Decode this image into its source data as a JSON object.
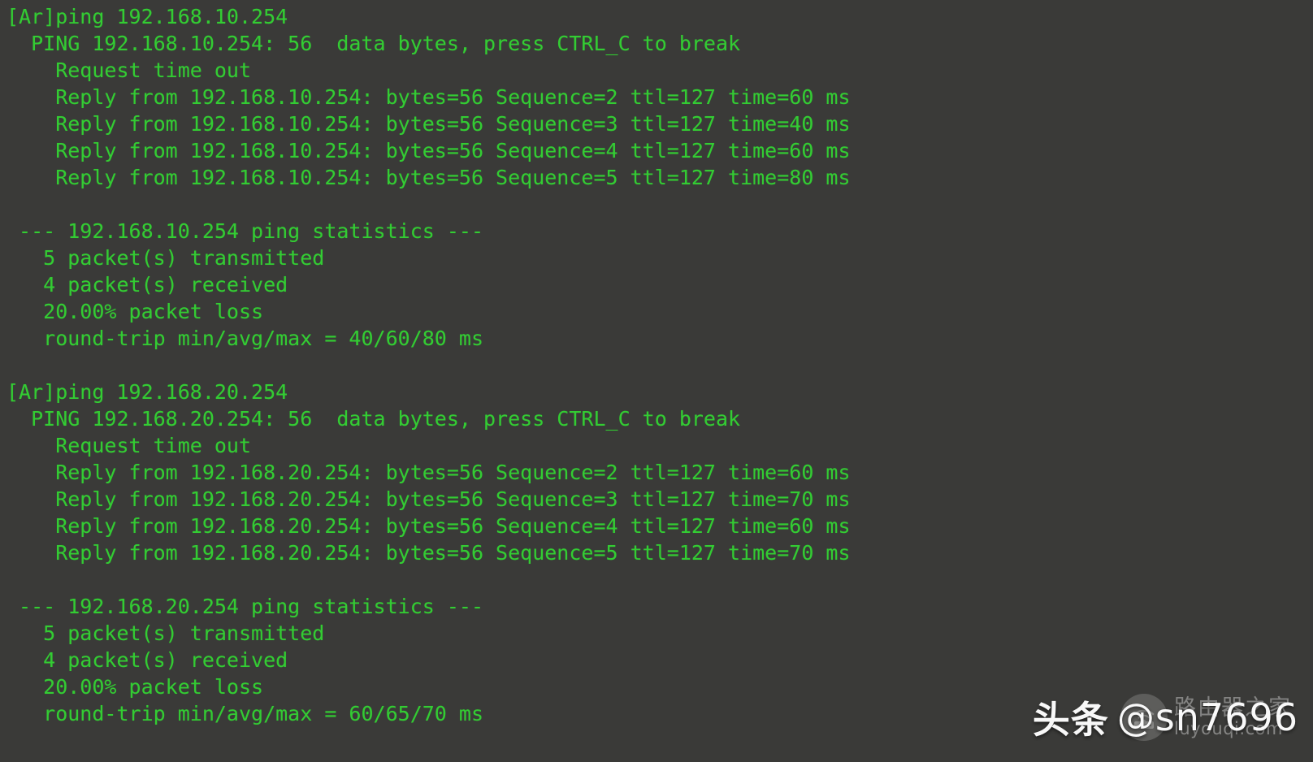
{
  "terminal": {
    "prompt_prefix": "[Ar]",
    "foreground_color": "#33cc33",
    "background_color": "#3a3a38",
    "lines": [
      "[Ar]ping 192.168.10.254",
      "  PING 192.168.10.254: 56  data bytes, press CTRL_C to break",
      "    Request time out",
      "    Reply from 192.168.10.254: bytes=56 Sequence=2 ttl=127 time=60 ms",
      "    Reply from 192.168.10.254: bytes=56 Sequence=3 ttl=127 time=40 ms",
      "    Reply from 192.168.10.254: bytes=56 Sequence=4 ttl=127 time=60 ms",
      "    Reply from 192.168.10.254: bytes=56 Sequence=5 ttl=127 time=80 ms",
      "",
      " --- 192.168.10.254 ping statistics ---",
      "   5 packet(s) transmitted",
      "   4 packet(s) received",
      "   20.00% packet loss",
      "   round-trip min/avg/max = 40/60/80 ms",
      "",
      "[Ar]ping 192.168.20.254",
      "  PING 192.168.20.254: 56  data bytes, press CTRL_C to break",
      "    Request time out",
      "    Reply from 192.168.20.254: bytes=56 Sequence=2 ttl=127 time=60 ms",
      "    Reply from 192.168.20.254: bytes=56 Sequence=3 ttl=127 time=70 ms",
      "    Reply from 192.168.20.254: bytes=56 Sequence=4 ttl=127 time=60 ms",
      "    Reply from 192.168.20.254: bytes=56 Sequence=5 ttl=127 time=70 ms",
      "",
      " --- 192.168.20.254 ping statistics ---",
      "   5 packet(s) transmitted",
      "   4 packet(s) received",
      "   20.00% packet loss",
      "   round-trip min/avg/max = 60/65/70 ms"
    ],
    "sessions": [
      {
        "command": "ping 192.168.10.254",
        "target": "192.168.10.254",
        "data_bytes": "56",
        "ttl": "127",
        "replies": [
          {
            "sequence": "2",
            "bytes": "56",
            "ttl": "127",
            "time_ms": "60"
          },
          {
            "sequence": "3",
            "bytes": "56",
            "ttl": "127",
            "time_ms": "40"
          },
          {
            "sequence": "4",
            "bytes": "56",
            "ttl": "127",
            "time_ms": "60"
          },
          {
            "sequence": "5",
            "bytes": "56",
            "ttl": "127",
            "time_ms": "80"
          }
        ],
        "timeouts": 1,
        "statistics": {
          "transmitted": "5",
          "received": "4",
          "packet_loss": "20.00%",
          "round_trip_min": "40",
          "round_trip_avg": "60",
          "round_trip_max": "80",
          "unit": "ms"
        }
      },
      {
        "command": "ping 192.168.20.254",
        "target": "192.168.20.254",
        "data_bytes": "56",
        "ttl": "127",
        "replies": [
          {
            "sequence": "2",
            "bytes": "56",
            "ttl": "127",
            "time_ms": "60"
          },
          {
            "sequence": "3",
            "bytes": "56",
            "ttl": "127",
            "time_ms": "70"
          },
          {
            "sequence": "4",
            "bytes": "56",
            "ttl": "127",
            "time_ms": "60"
          },
          {
            "sequence": "5",
            "bytes": "56",
            "ttl": "127",
            "time_ms": "70"
          }
        ],
        "timeouts": 1,
        "statistics": {
          "transmitted": "5",
          "received": "4",
          "packet_loss": "20.00%",
          "round_trip_min": "60",
          "round_trip_avg": "65",
          "round_trip_max": "70",
          "unit": "ms"
        }
      }
    ]
  },
  "watermarks": {
    "toutiao": {
      "platform_label": "头条",
      "handle": "@sn7696",
      "color": "#ffffff"
    },
    "router_site": {
      "icon": "router-wifi-icon",
      "site_label": "路由器之家",
      "url": "luyouqi.com",
      "color": "#e8e8e8"
    }
  }
}
